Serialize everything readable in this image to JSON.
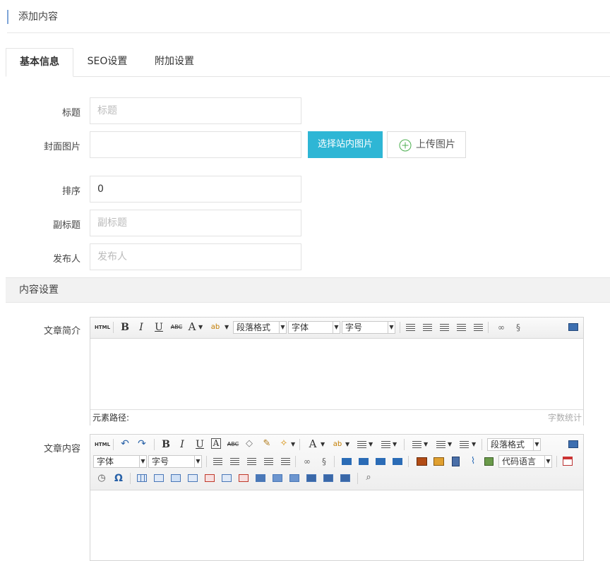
{
  "page_title": "添加内容",
  "tabs": [
    {
      "label": "基本信息",
      "active": true
    },
    {
      "label": "SEO设置",
      "active": false
    },
    {
      "label": "附加设置",
      "active": false
    }
  ],
  "form": {
    "title": {
      "label": "标题",
      "placeholder": "标题",
      "value": ""
    },
    "cover": {
      "label": "封面图片",
      "value": "",
      "select_button": "选择站内图片",
      "upload_button": "上传图片"
    },
    "sort": {
      "label": "排序",
      "value": "0"
    },
    "subtitle": {
      "label": "副标题",
      "placeholder": "副标题",
      "value": ""
    },
    "publisher": {
      "label": "发布人",
      "placeholder": "发布人",
      "value": ""
    }
  },
  "content_section": {
    "title": "内容设置"
  },
  "summary_editor": {
    "label": "文章简介",
    "paragraph_select": "段落格式",
    "font_select": "字体",
    "size_select": "字号",
    "status_path": "元素路径:",
    "word_count": "字数统计",
    "html_label": "HTML",
    "bold": "B",
    "italic": "I",
    "underline": "U",
    "strike": "ABC",
    "font_color": "A",
    "bg_color": "ab"
  },
  "content_editor": {
    "label": "文章内容",
    "paragraph_select": "段落格式",
    "font_select": "字体",
    "size_select": "字号",
    "code_select": "代码语言",
    "html_label": "HTML",
    "bold": "B",
    "italic": "I",
    "underline": "U",
    "boxed_a": "A",
    "strike": "ABC",
    "font_color": "A",
    "bg_color": "ab",
    "omega": "Ω"
  },
  "colors": {
    "accent": "#2eb6d5",
    "title_bar": "#7fa6d8",
    "section_bg": "#f2f2f2"
  }
}
